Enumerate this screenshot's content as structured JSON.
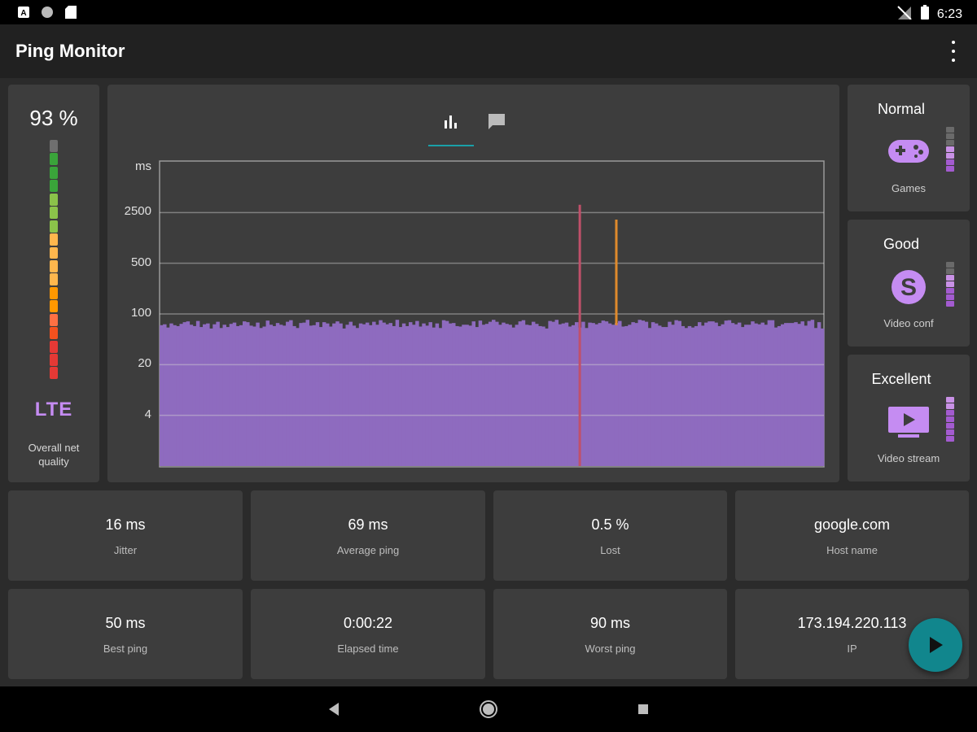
{
  "status_bar": {
    "time": "6:23",
    "left_icons": [
      "notification-a-icon",
      "circle-icon",
      "sd-card-icon"
    ],
    "right_icons": [
      "no-signal-icon",
      "battery-icon"
    ]
  },
  "app_bar": {
    "title": "Ping Monitor",
    "overflow_icon": "more-vertical-icon"
  },
  "overall_quality": {
    "percent_text": "93 %",
    "network_type": "LTE",
    "caption": "Overall net quality",
    "meter_level": 0.93,
    "meter_colors": [
      "#6f6f6f",
      "#3aa43a",
      "#3aa43a",
      "#3aa43a",
      "#8bc34a",
      "#8bc34a",
      "#8bc34a",
      "#ffb74d",
      "#ffb74d",
      "#ffb74d",
      "#ffb74d",
      "#ff9800",
      "#ff9800",
      "#ff7043",
      "#f4511e",
      "#e53935",
      "#e53935",
      "#e53935"
    ]
  },
  "chart_tabs": [
    {
      "icon": "bar-chart-icon",
      "active": true
    },
    {
      "icon": "comment-icon",
      "active": false
    }
  ],
  "chart_data": {
    "type": "bar",
    "y_unit_label": "ms",
    "y_scale": "log",
    "y_ticks": [
      "2500",
      "500",
      "100",
      "20",
      "4"
    ],
    "y_tick_values": [
      2500,
      500,
      100,
      20,
      4
    ],
    "ylim": [
      0.8,
      12500
    ],
    "grid": true,
    "bar_color": "#8e6bbf",
    "series": [
      {
        "values": [
          70,
          72,
          65,
          74,
          70,
          68,
          73,
          77,
          79,
          71,
          68,
          80,
          66,
          72,
          74,
          63,
          72,
          78,
          64,
          71,
          66,
          73,
          76,
          68,
          70,
          79,
          77,
          69,
          67,
          76,
          64,
          67,
          81,
          71,
          68,
          75,
          71,
          69,
          78,
          82,
          68,
          64,
          75,
          76,
          83,
          69,
          70,
          77,
          66,
          77,
          74,
          67,
          74,
          79,
          74,
          63,
          71,
          78,
          69,
          64,
          74,
          72,
          76,
          70,
          78,
          71,
          82,
          76,
          72,
          75,
          68,
          83,
          66,
          74,
          68,
          77,
          71,
          80,
          67,
          74,
          69,
          77,
          65,
          74,
          64,
          82,
          80,
          74,
          75,
          68,
          67,
          71,
          71,
          69,
          79,
          66,
          81,
          71,
          73,
          78,
          83,
          78,
          71,
          76,
          73,
          71,
          65,
          71,
          79,
          82,
          71,
          70,
          78,
          73,
          68,
          67,
          63,
          80,
          78,
          83,
          72,
          74,
          76,
          67,
          70,
          77,
          65,
          78,
          64,
          76,
          75,
          72,
          75,
          81,
          79,
          74,
          71,
          75,
          80,
          67,
          68,
          71,
          77,
          75,
          83,
          81,
          78,
          64,
          77,
          74,
          69,
          66,
          66,
          78,
          71,
          82,
          80,
          68,
          64,
          68,
          65,
          68,
          77,
          69,
          76,
          79,
          79,
          76,
          68,
          72,
          81,
          82,
          75,
          72,
          76,
          66,
          71,
          71,
          79,
          74,
          72,
          76,
          71,
          82,
          82,
          65,
          68,
          72,
          75,
          75,
          75,
          77,
          73,
          79,
          69,
          80,
          83,
          64,
          77,
          63
        ]
      }
    ],
    "spikes": [
      {
        "index": 126,
        "value": 3200,
        "color": "#c0506a"
      },
      {
        "index": 137,
        "value": 2000,
        "color": "#e08a2c"
      }
    ]
  },
  "profiles": [
    {
      "status": "Normal",
      "caption": "Games",
      "icon": "gamepad-icon",
      "level": 0.5
    },
    {
      "status": "Good",
      "caption": "Video conf",
      "icon": "skype-icon",
      "level": 0.75
    },
    {
      "status": "Excellent",
      "caption": "Video stream",
      "icon": "play-screen-icon",
      "level": 0.95
    }
  ],
  "stats": [
    {
      "value": "16 ms",
      "label": "Jitter"
    },
    {
      "value": "69 ms",
      "label": "Average ping"
    },
    {
      "value": "0.5 %",
      "label": "Lost"
    },
    {
      "value": "google.com",
      "label": "Host name"
    },
    {
      "value": "50 ms",
      "label": "Best ping"
    },
    {
      "value": "0:00:22",
      "label": "Elapsed time"
    },
    {
      "value": "90 ms",
      "label": "Worst ping"
    },
    {
      "value": "173.194.220.113",
      "label": "IP"
    }
  ],
  "fab": {
    "icon": "play-icon",
    "color": "#11868d"
  },
  "nav_bar": {
    "buttons": [
      "back-icon",
      "home-icon",
      "recents-icon"
    ]
  }
}
